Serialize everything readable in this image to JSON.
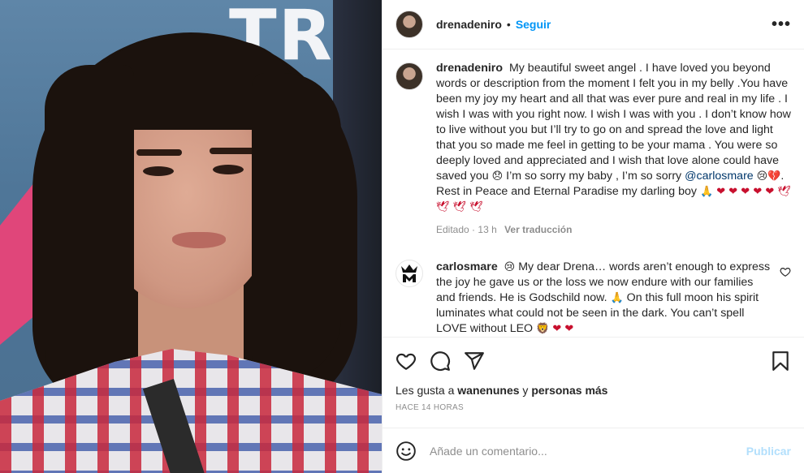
{
  "photo": {
    "wall_text": "TR  E\nT   V"
  },
  "header": {
    "username": "drenadeniro",
    "separator": "•",
    "follow_label": "Seguir",
    "more_label": "•••"
  },
  "caption": {
    "username": "drenadeniro",
    "text_part1": "My beautiful sweet angel . I have loved you beyond words or description from the moment I felt you in my belly .You have been my joy my heart and all that was ever pure and real in my life . I wish I was with you right now. I wish I was with you . I don’t know how to live without you but I’ll try to go on and spread the love and light that you so made me feel in getting to be your mama . You were so deeply loved and appreciated and I wish that love alone could have saved you",
    "emoji1": "😞",
    "text_part2": "I’m so sorry my baby , I’m so sorry",
    "mention": "@carlosmare",
    "emoji2": "😢",
    "emoji3": "💔",
    "text_part3": ". Rest in Peace and Eternal Paradise my darling boy",
    "emoji_tail": "🙏 ❤ ❤ ❤ ❤ ❤ 🕊 🕊 🕊 🕊",
    "edited": "Editado",
    "time": "13 h",
    "see_translation": "Ver traducción"
  },
  "comment": {
    "username": "carlosmare",
    "emoji1": "😢",
    "text_part1": "My dear Drena… words aren’t enough to express the joy he gave us or the loss we now endure with our families and friends. He is Godschild now.",
    "emoji2": "🙏",
    "text_part2": "On this full moon his spirit luminates what could not be seen in the dark. You can’t spell LOVE without LEO",
    "emoji_tail": "🦁 ❤ ❤"
  },
  "likes": {
    "prefix": "Les gusta a",
    "user": "wanenunes",
    "connector": "y",
    "others": "personas más"
  },
  "timestamp": "HACE 14 HORAS",
  "add_comment": {
    "placeholder": "Añade un comentario...",
    "publish_label": "Publicar"
  },
  "colors": {
    "accent": "#0095f6",
    "heart": "#c8102e",
    "muted": "#8e8e8e"
  }
}
